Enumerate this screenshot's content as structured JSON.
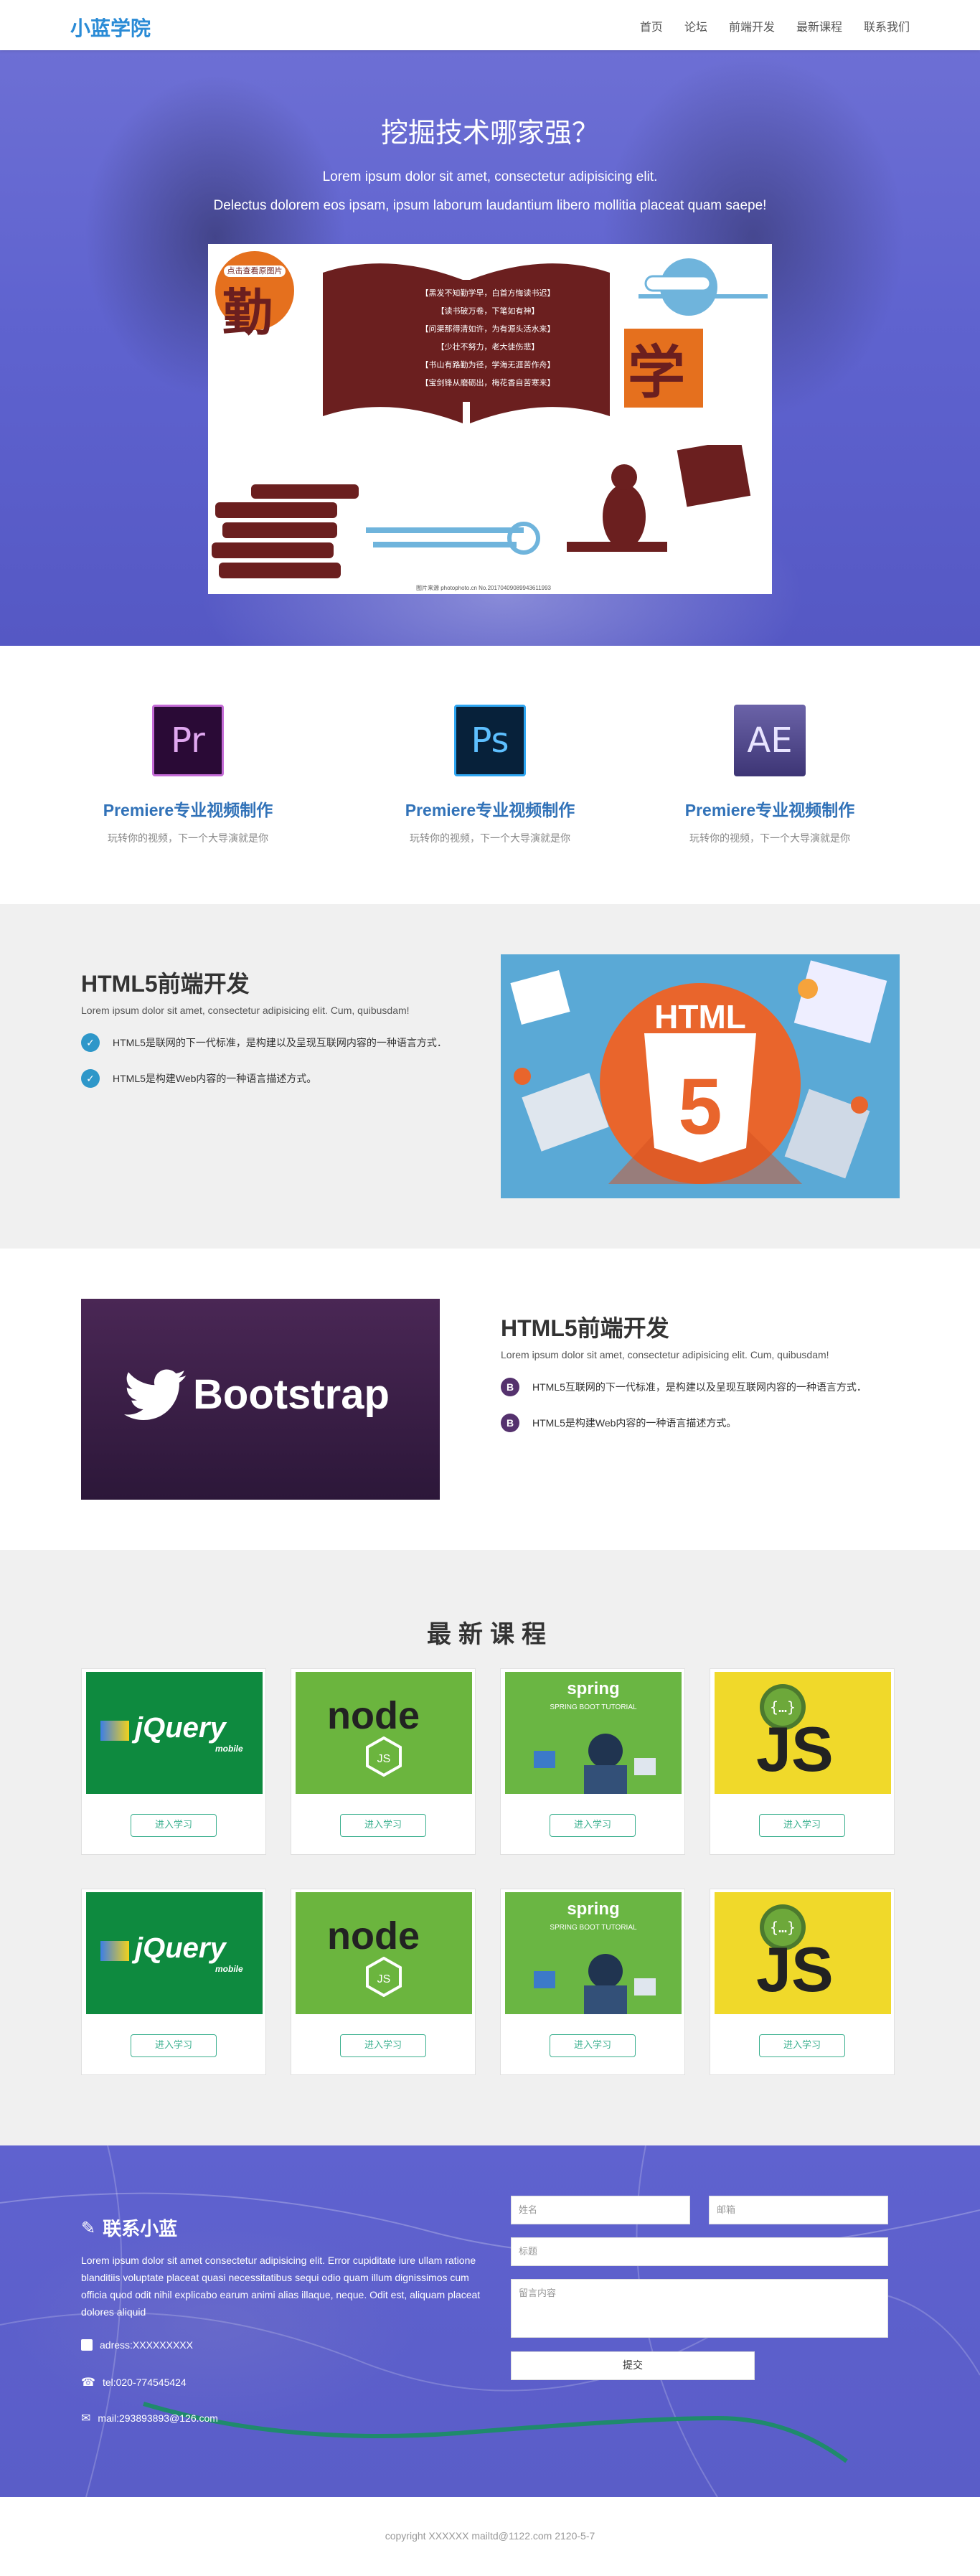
{
  "nav": {
    "brand": "小蓝学院",
    "items": [
      "首页",
      "论坛",
      "前端开发",
      "最新课程",
      "联系我们"
    ]
  },
  "hero": {
    "title": "挖掘技术哪家强？",
    "sub1": "Lorem ipsum dolor sit amet, consectetur adipisicing elit.",
    "sub2": "Delectus dolorem eos ipsam, ipsum laborum laudantium libero mollitia placeat quam saepe!",
    "poster": {
      "badge": "点击查看原图片",
      "char_left": "勤",
      "char_right": "学",
      "lines": [
        "【黑发不知勤学早，白首方悔读书迟】",
        "【读书破万卷，下笔如有神】",
        "【问渠那得清如许，为有源头活水来】",
        "【少壮不努力，老大徒伤悲】",
        "【书山有路勤为径，学海无涯苦作舟】",
        "【宝剑锋从磨砺出，梅花香自苦寒来】"
      ],
      "footer": "图片来源 photophoto.cn No.20170409089943611993"
    }
  },
  "features": [
    {
      "icon": "premiere-icon",
      "glyph": "Pr",
      "title": "Premiere专业视频制作",
      "desc": "玩转你的视频，下一个大导演就是你"
    },
    {
      "icon": "photoshop-icon",
      "glyph": "Ps",
      "title": "Premiere专业视频制作",
      "desc": "玩转你的视频，下一个大导演就是你"
    },
    {
      "icon": "after-effects-icon",
      "glyph": "AE",
      "title": "Premiere专业视频制作",
      "desc": "玩转你的视频，下一个大导演就是你"
    }
  ],
  "sectionA": {
    "title": "HTML5前端开发",
    "desc": "Lorem ipsum dolor sit amet, consectetur adipisicing elit. Cum, quibusdam!",
    "items": [
      "HTML5是联网的下一代标准，是构建以及呈现互联网内容的一种语言方式．",
      "HTML5是构建Web内容的一种语言描述方式。"
    ],
    "image_text": "HTML",
    "image_number": "5"
  },
  "sectionB": {
    "title": "HTML5前端开发",
    "desc": "Lorem ipsum dolor sit amet, consectetur adipisicing elit. Cum, quibusdam!",
    "items": [
      "HTML5互联网的下一代标准，是构建以及呈现互联网内容的一种语言方式．",
      "HTML5是构建Web内容的一种语言描述方式。"
    ],
    "image_text": "Bootstrap"
  },
  "courses": {
    "title": "最新课程",
    "button": "进入学习",
    "labels": {
      "jquery": "jQuery",
      "jquery_sub": "mobile",
      "node": "node",
      "spring": "spring",
      "spring_sub": "SPRING BOOT TUTORIAL",
      "js": "JS"
    }
  },
  "contact": {
    "title": "联系小蓝",
    "desc": "Lorem ipsum dolor sit amet consectetur adipisicing elit. Error cupiditate iure ullam ratione blanditiis voluptate placeat quasi necessitatibus sequi odio quam illum dignissimos cum officia quod odit nihil explicabo earum animi alias illaque, neque. Odit est, aliquam placeat dolores aliquid",
    "address": "adress:XXXXXXXXX",
    "tel": "tel:020-774545424",
    "mail": "mail:293893893@126.com",
    "fields": {
      "name": "姓名",
      "email": "邮箱",
      "subject": "标题",
      "message": "留言内容"
    },
    "submit": "提交"
  },
  "footer": "copyright  XXXXXX mailtd@1122.com 2120-5-7"
}
